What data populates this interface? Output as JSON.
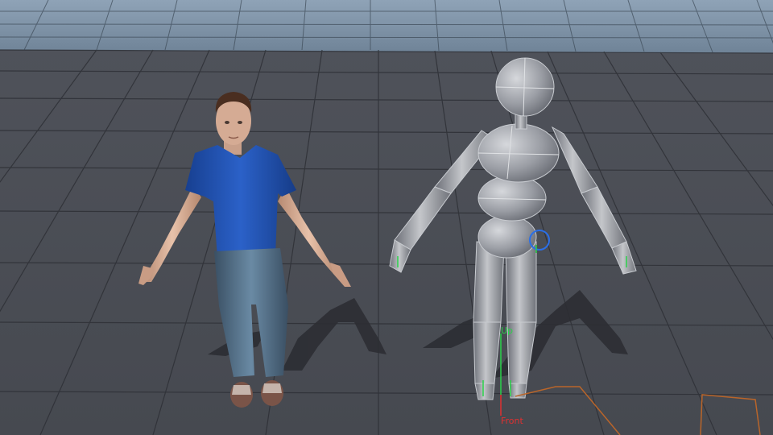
{
  "viewport": {
    "background_color": "#4a4d55",
    "far_floor_color": "#7c90a4",
    "grid_line_color": "#2e3036"
  },
  "characters": [
    {
      "name": "human-character",
      "shirt_color": "#1f52b5",
      "jeans_color": "#49637a",
      "skin_color": "#d9b29a"
    },
    {
      "name": "proxy-mannequin",
      "body_color": "#8a8d94",
      "edge_color": "#c8cbd0"
    }
  ],
  "gizmo": {
    "up_label": "Up",
    "front_label": "Front",
    "up_color": "#2ad34a",
    "front_color": "#e03030",
    "ring_color": "#2a6fe8"
  },
  "selection_outline_color": "#b9652a"
}
